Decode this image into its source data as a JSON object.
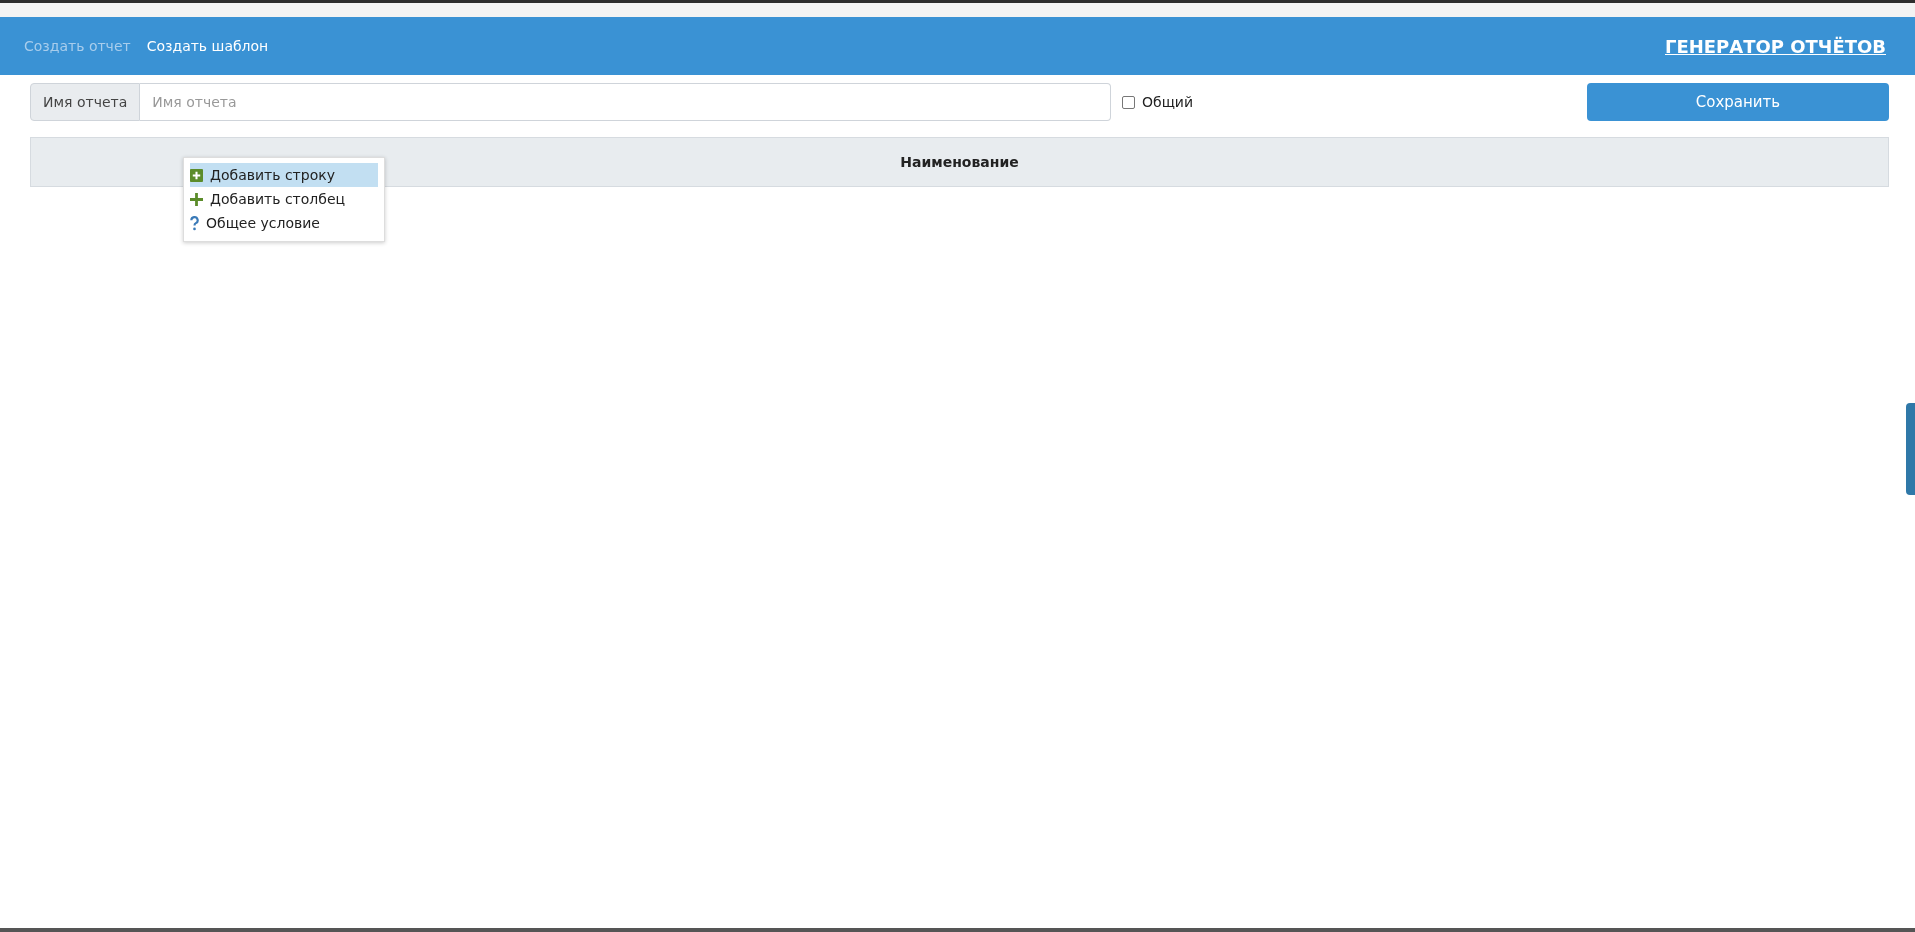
{
  "nav": {
    "items": [
      {
        "label": "Создать отчет",
        "selected": false
      },
      {
        "label": "Создать шаблон",
        "selected": true
      }
    ],
    "brand": "ГЕНЕРАТОР ОТЧЁТОВ"
  },
  "form": {
    "label": "Имя отчета",
    "placeholder": "Имя отчета",
    "shared": {
      "label": "Общий",
      "checked": false
    },
    "save_button": "Сохранить"
  },
  "table": {
    "columns": [
      "Наименование"
    ]
  },
  "context_menu": {
    "items": [
      {
        "kind": "add-square",
        "label": "Добавить строку",
        "selected": true
      },
      {
        "kind": "add-plus",
        "label": "Добавить столбец",
        "selected": false
      },
      {
        "kind": "question",
        "label": "Общее условие",
        "selected": false
      }
    ]
  }
}
